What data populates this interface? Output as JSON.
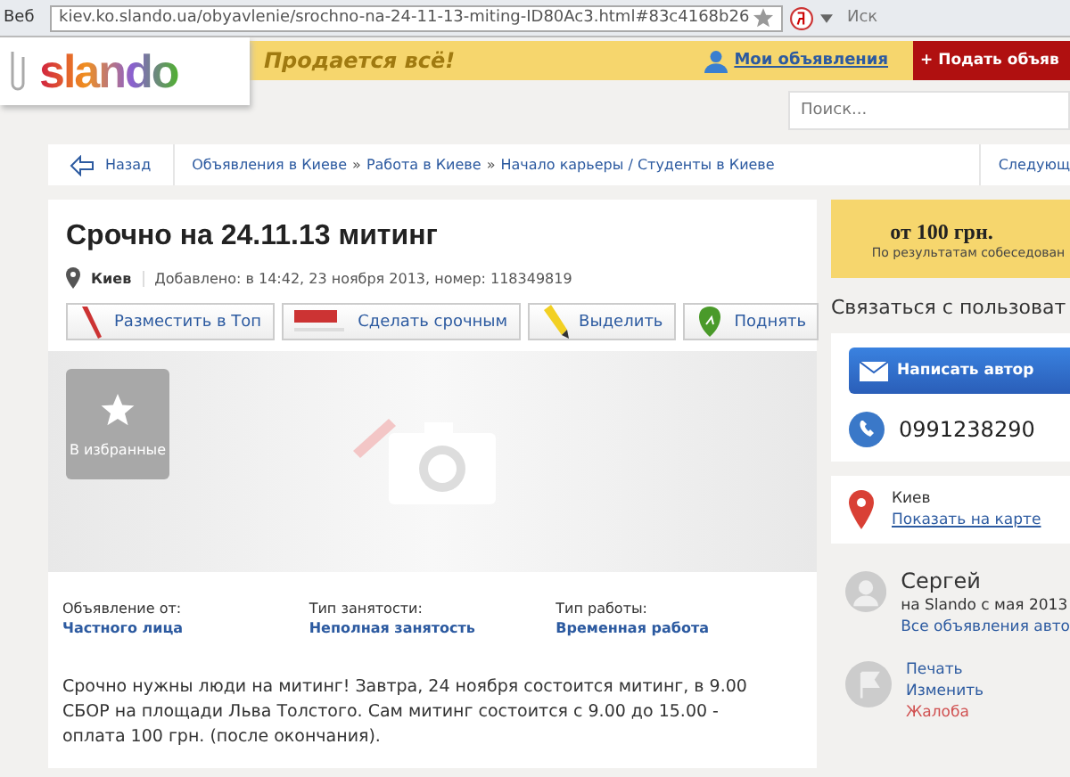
{
  "browser": {
    "tab": "Веб",
    "url": "kiev.ko.slando.ua/obyavlenie/srochno-na-24-11-13-miting-ID80Ac3.html#83c4168b26",
    "search_engine": "Иск"
  },
  "header": {
    "logo": "slando",
    "slogan": "Продается всё!",
    "my_ads": "Мои объявления",
    "post_button": "+ Подать объяв"
  },
  "search": {
    "placeholder": "Поиск..."
  },
  "breadcrumbs": {
    "back": "Назад",
    "items": [
      "Объявления в Киеве",
      "Работа в Киеве",
      "Начало карьеры / Студенты в Киеве"
    ],
    "next": "Следующ",
    "separator": "»"
  },
  "ad": {
    "title": "Срочно на 24.11.13 митинг",
    "city": "Киев",
    "added": "Добавлено: в 14:42, 23 ноября 2013, номер: 118349819",
    "actions": [
      {
        "label": "Разместить в Топ",
        "kind": "pen"
      },
      {
        "label": "Сделать срочным",
        "kind": "urgent"
      },
      {
        "label": "Выделить",
        "kind": "marker"
      },
      {
        "label": "Поднять",
        "kind": "up"
      }
    ],
    "favorite": "В избранные",
    "params": [
      {
        "name": "Объявление от:",
        "value": "Частного лица"
      },
      {
        "name": "Тип занятости:",
        "value": "Неполная занятость"
      },
      {
        "name": "Тип работы:",
        "value": "Временная работа"
      }
    ],
    "description": "Срочно нужны люди на митинг! Завтра, 24 ноября состоится митинг, в 9.00 СБОР на площади Льва Толстого. Сам митинг состоится с 9.00 до 15.00 - оплата 100 грн. (после окончания)."
  },
  "sidebar": {
    "price": "от 100 грн.",
    "price_note": "По результатам собеседован",
    "contact_heading": "Связаться с пользоват",
    "write_button": "Написать автор",
    "phone": "0991238290",
    "city": "Киев",
    "map_link": "Показать на карте",
    "user": {
      "name": "Сергей",
      "since": "на Slando с мая 2013",
      "all_ads": "Все объявления авто"
    },
    "links": [
      {
        "label": "Печать",
        "kind": "normal"
      },
      {
        "label": "Изменить",
        "kind": "normal"
      },
      {
        "label": "Жалоба",
        "kind": "warning"
      }
    ]
  }
}
